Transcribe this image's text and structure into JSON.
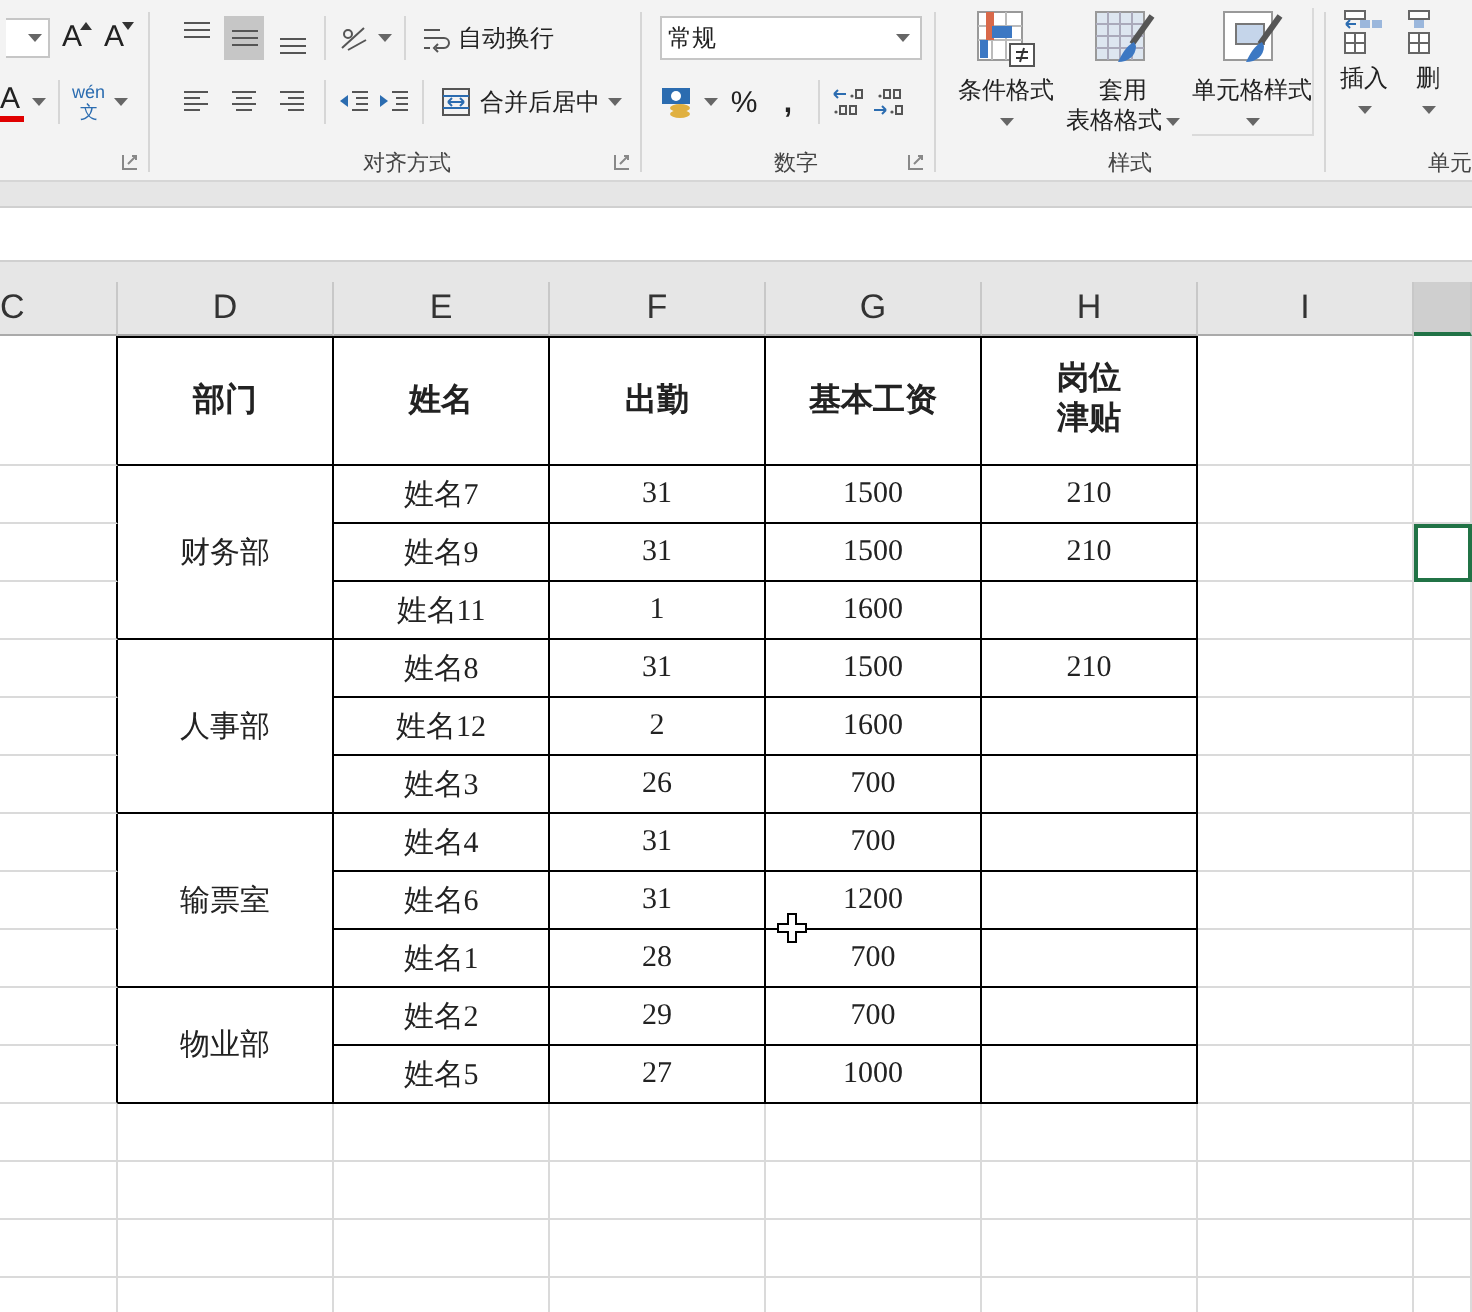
{
  "ribbon": {
    "font": {
      "grow": "A",
      "shrink": "A",
      "color_letter": "A",
      "phonetic_top": "wén",
      "phonetic_bottom": "文"
    },
    "alignment": {
      "vertical": [
        {
          "selected": false
        },
        {
          "selected": true
        },
        {
          "selected": false
        }
      ],
      "horizontal": [
        {
          "selected": false
        },
        {
          "selected": false
        },
        {
          "selected": false
        }
      ],
      "wrap_text": "自动换行",
      "merge": "合并后居中",
      "label": "对齐方式"
    },
    "number": {
      "format": "常规",
      "percent": "%",
      "comma": ",",
      "label": "数字"
    },
    "styles": {
      "buttons": [
        {
          "lines": [
            "条件格式"
          ],
          "kind": "conditional"
        },
        {
          "lines": [
            "套用",
            "表格格式"
          ],
          "kind": "table"
        },
        {
          "lines": [
            "单元格样式"
          ],
          "kind": "cell"
        }
      ],
      "label": "样式"
    },
    "cells": {
      "buttons": [
        {
          "label": "插入",
          "kind": "insert"
        },
        {
          "label": "删",
          "kind": "delete"
        }
      ],
      "label": "单元"
    }
  },
  "columns": [
    {
      "label": "C",
      "selected": false
    },
    {
      "label": "D",
      "selected": false
    },
    {
      "label": "E",
      "selected": false
    },
    {
      "label": "F",
      "selected": false
    },
    {
      "label": "G",
      "selected": false
    },
    {
      "label": "H",
      "selected": false
    },
    {
      "label": "I",
      "selected": false
    },
    {
      "selected": true
    }
  ],
  "table": {
    "headers": [
      {
        "text": "部门",
        "wrap": false
      },
      {
        "text": "姓名",
        "wrap": false
      },
      {
        "text": "出勤",
        "wrap": false
      },
      {
        "text": "基本工资",
        "wrap": false
      },
      {
        "text": "岗位津贴",
        "wrap": true
      }
    ],
    "departments": [
      {
        "name": "财务部",
        "rows": [
          {
            "name": "姓名7",
            "attendance": "31",
            "salary": "1500",
            "allowance": "210",
            "active_cell_in_next_column": false
          },
          {
            "name": "姓名9",
            "attendance": "31",
            "salary": "1500",
            "allowance": "210",
            "active_cell_in_next_column": true
          },
          {
            "name": "姓名11",
            "attendance": "1",
            "salary": "1600",
            "active_cell_in_next_column": false
          }
        ]
      },
      {
        "name": "人事部",
        "rows": [
          {
            "name": "姓名8",
            "attendance": "31",
            "salary": "1500",
            "allowance": "210",
            "active_cell_in_next_column": false
          },
          {
            "name": "姓名12",
            "attendance": "2",
            "salary": "1600",
            "active_cell_in_next_column": false
          },
          {
            "name": "姓名3",
            "attendance": "26",
            "salary": "700",
            "active_cell_in_next_column": false
          }
        ]
      },
      {
        "name": "输票室",
        "rows": [
          {
            "name": "姓名4",
            "attendance": "31",
            "salary": "700",
            "active_cell_in_next_column": false
          },
          {
            "name": "姓名6",
            "attendance": "31",
            "salary": "1200",
            "active_cell_in_next_column": false
          },
          {
            "name": "姓名1",
            "attendance": "28",
            "salary": "700",
            "active_cell_in_next_column": false
          }
        ]
      },
      {
        "name": "物业部",
        "rows": [
          {
            "name": "姓名2",
            "attendance": "29",
            "salary": "700",
            "active_cell_in_next_column": false
          },
          {
            "name": "姓名5",
            "attendance": "27",
            "salary": "1000",
            "active_cell_in_next_column": false
          }
        ]
      }
    ]
  }
}
